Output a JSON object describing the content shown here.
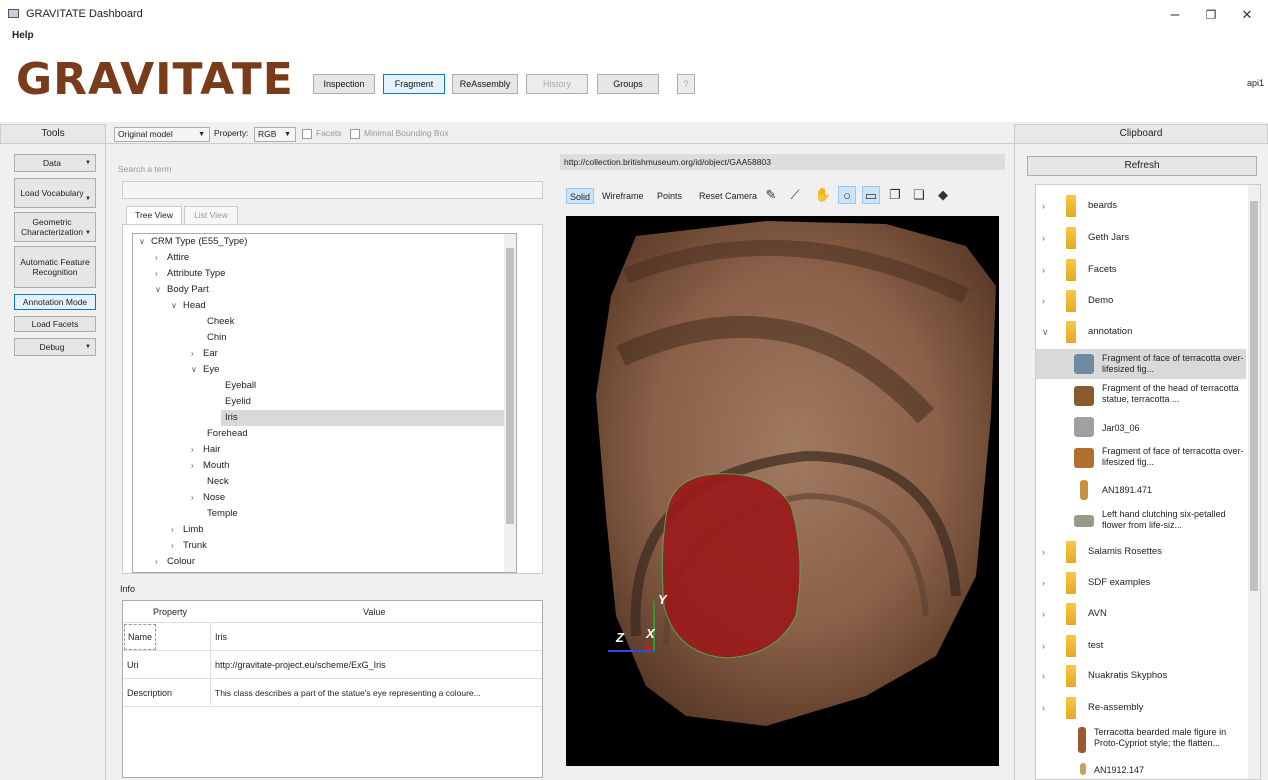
{
  "window": {
    "title": "GRAVITATE Dashboard",
    "minimize": "–",
    "restore": "❐",
    "close": "✕"
  },
  "menu": {
    "help": "Help"
  },
  "logo": {
    "text": "GRAVITATE"
  },
  "nav": {
    "inspection": "Inspection",
    "fragment": "Fragment",
    "reassembly": "ReAssembly",
    "history": "History",
    "groups": "Groups",
    "help": "?",
    "user": "api1"
  },
  "tools": {
    "title": "Tools",
    "data": "Data",
    "load_vocabulary": "Load Vocabulary",
    "geometric": "Geometric Characterization",
    "automatic": "Automatic Feature Recognition",
    "annotation": "Annotation Mode",
    "load_facets": "Load Facets",
    "debug": "Debug"
  },
  "toolbar": {
    "model": "Original model",
    "property_label": "Property:",
    "property_value": "RGB",
    "facets": "Facets",
    "minimal_bbox": "Minimal Bounding Box"
  },
  "search": {
    "label": "Search a term"
  },
  "tabs": {
    "tree": "Tree View",
    "list": "List View"
  },
  "tree": [
    "CRM Type (E55_Type)",
    "Attire",
    "Attribute Type",
    "Body Part",
    "Head",
    "Cheek",
    "Chin",
    "Ear",
    "Eye",
    "Eyeball",
    "Eyelid",
    "Iris",
    "Forehead",
    "Hair",
    "Mouth",
    "Neck",
    "Nose",
    "Temple",
    "Limb",
    "Trunk",
    "Colour"
  ],
  "info": {
    "label": "Info",
    "col_property": "Property",
    "col_value": "Value",
    "rows": [
      {
        "k": "Name",
        "v": "Iris"
      },
      {
        "k": "Uri",
        "v": "http://gravitate-project.eu/scheme/ExG_Iris"
      },
      {
        "k": "Description",
        "v": "This class describes a part of the statue's eye representing a coloure..."
      }
    ]
  },
  "viewer": {
    "url": "http://collection.britishmuseum.org/id/object/GAA58803",
    "solid": "Solid",
    "wireframe": "Wireframe",
    "points": "Points",
    "reset": "Reset Camera",
    "axis_y": "Y",
    "axis_z": "Z",
    "axis_x": "X"
  },
  "clipboard": {
    "title": "Clipboard",
    "refresh": "Refresh",
    "folders": {
      "beards": "beards",
      "geth": "Geth Jars",
      "facets": "Facets",
      "demo": "Demo",
      "annotation": "annotation",
      "salamis": "Salamis Rosettes",
      "sdf": "SDF examples",
      "avn": "AVN",
      "test": "test",
      "naukratis": "Nuakratis Skyphos",
      "reassembly": "Re-assembly"
    },
    "items": [
      "Fragment of face of terracotta over-lifesized fig...",
      "Fragment of the head of terracotta statue, terracotta ...",
      "Jar03_06",
      "Fragment of face of terracotta over-lifesized fig...",
      "AN1891.471",
      "Left hand clutching six-petalled flower from life-siz...",
      "Terracotta bearded male figure in Proto-Cypriot style; the flatten...",
      "AN1912.147"
    ]
  },
  "colors": {
    "accent": "#0078d7",
    "folder": "#f0b530",
    "highlight": "#9b1b1b"
  }
}
